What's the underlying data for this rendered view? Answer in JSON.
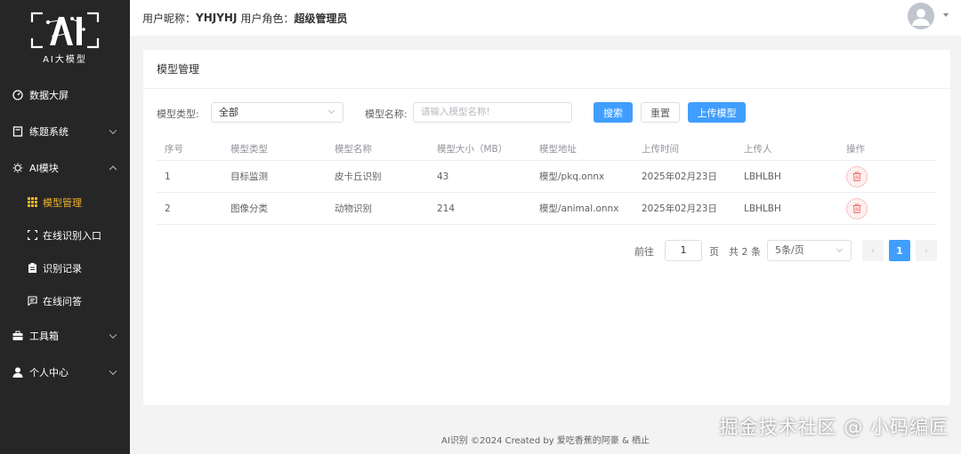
{
  "logo": {
    "text": "AI大模型"
  },
  "sidebar": {
    "items": [
      {
        "label": "数据大屏",
        "icon": "dashboard-icon"
      },
      {
        "label": "练题系统",
        "icon": "book-icon"
      },
      {
        "label": "AI模块",
        "icon": "sun-icon"
      },
      {
        "label": "工具箱",
        "icon": "toolbox-icon"
      },
      {
        "label": "个人中心",
        "icon": "user-icon"
      }
    ],
    "sub_items": [
      {
        "label": "模型管理",
        "icon": "grid-icon",
        "active": true
      },
      {
        "label": "在线识别入口",
        "icon": "scan-icon"
      },
      {
        "label": "识别记录",
        "icon": "clipboard-icon"
      },
      {
        "label": "在线问答",
        "icon": "chat-icon"
      }
    ]
  },
  "header": {
    "nickname_label": "用户昵称：",
    "nickname": "YHJYHJ",
    "role_label": "用户角色：",
    "role": "超级管理员"
  },
  "card": {
    "title": "模型管理"
  },
  "search": {
    "type_label": "模型类型:",
    "type_value": "全部",
    "name_label": "模型名称:",
    "name_placeholder": "请输入模型名称!",
    "search_button": "搜索",
    "reset_button": "重置",
    "upload_button": "上传模型"
  },
  "table": {
    "columns": [
      "序号",
      "模型类型",
      "模型名称",
      "模型大小（MB）",
      "模型地址",
      "上传时间",
      "上传人",
      "操作"
    ],
    "rows": [
      [
        "1",
        "目标监测",
        "皮卡丘识别",
        "43",
        "模型/pkq.onnx",
        "2025年02月23日",
        "LBHLBH"
      ],
      [
        "2",
        "图像分类",
        "动物识别",
        "214",
        "模型/animal.onnx",
        "2025年02月23日",
        "LBHLBH"
      ]
    ]
  },
  "pagination": {
    "goto_label": "前往",
    "page_value": "1",
    "page_unit": "页",
    "total_text": "共 2 条",
    "page_size": "5条/页",
    "current_page": "1",
    "prev": "‹",
    "next": "›"
  },
  "footer": {
    "text": "AI识别 ©2024 Created by 爱吃香蕉的阿豪 & 栖止"
  },
  "watermark": {
    "text": "掘金技术社区 @ 小码编匠"
  },
  "colors": {
    "primary": "#409eff",
    "sidebar_bg": "#262626",
    "active": "#f0b429",
    "danger": "#f56c6c"
  }
}
